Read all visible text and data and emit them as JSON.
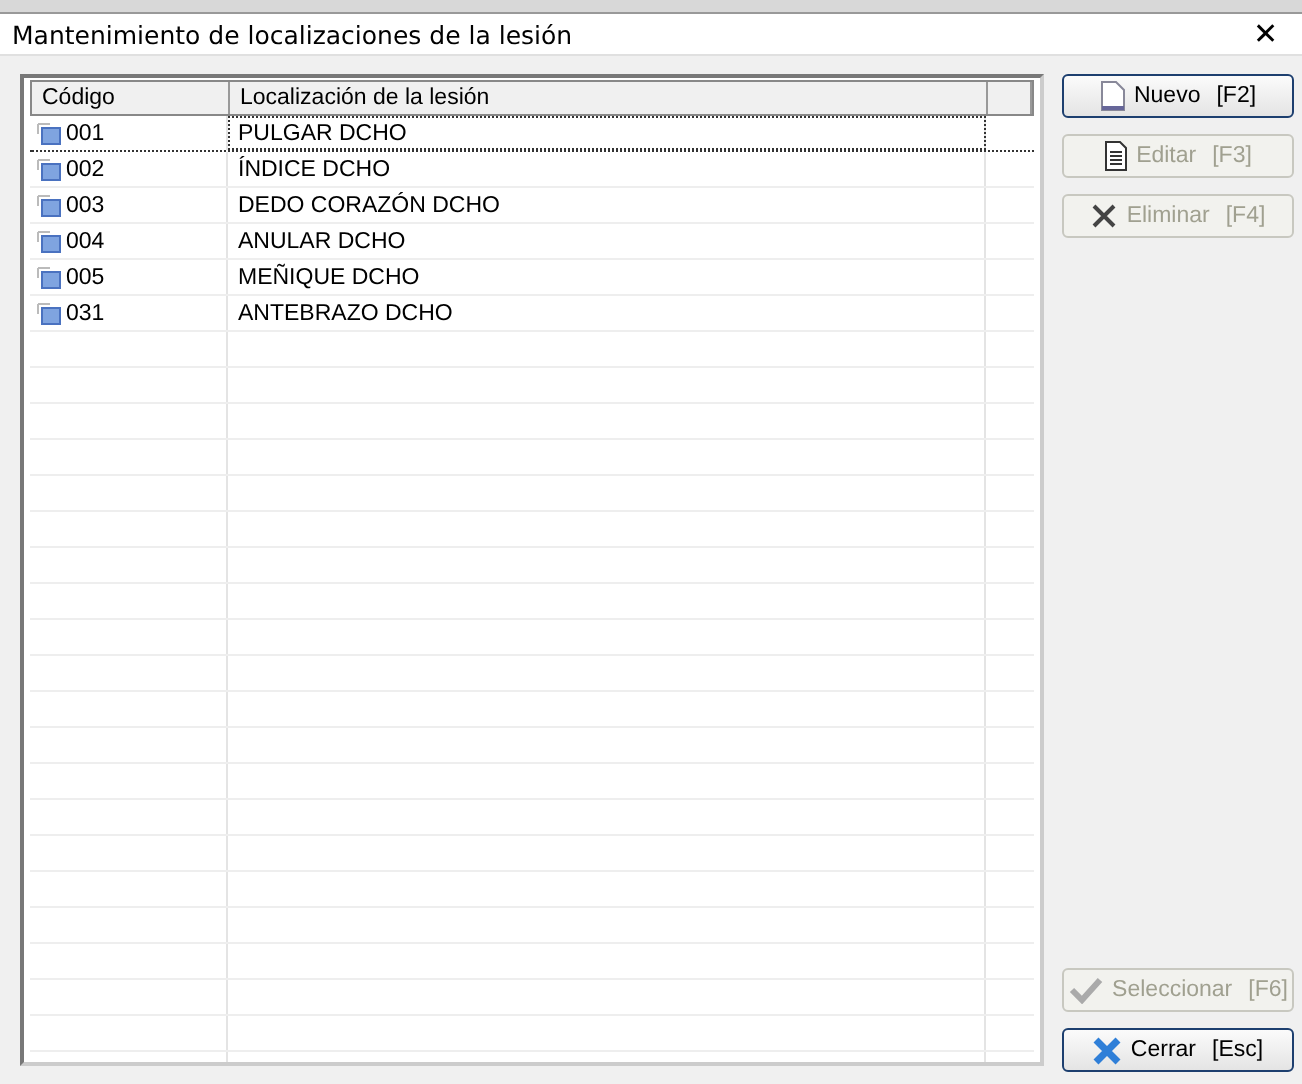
{
  "window": {
    "title": "Mantenimiento de localizaciones de la lesión",
    "close": "✕"
  },
  "table": {
    "columns": [
      "Código",
      "Localización de la lesión"
    ],
    "rows": [
      {
        "code": "001",
        "name": "PULGAR DCHO",
        "selected": true
      },
      {
        "code": "002",
        "name": "ÍNDICE DCHO",
        "selected": false
      },
      {
        "code": "003",
        "name": "DEDO CORAZÓN DCHO",
        "selected": false
      },
      {
        "code": "004",
        "name": "ANULAR DCHO",
        "selected": false
      },
      {
        "code": "005",
        "name": "MEÑIQUE DCHO",
        "selected": false
      },
      {
        "code": "031",
        "name": "ANTEBRAZO DCHO",
        "selected": false
      }
    ]
  },
  "buttons_top": [
    {
      "label": "Nuevo",
      "key": "[F2]",
      "kind": "new",
      "disabled": false
    },
    {
      "label": "Editar",
      "key": "[F3]",
      "kind": "edit",
      "disabled": true
    },
    {
      "label": "Eliminar",
      "key": "[F4]",
      "kind": "delete",
      "disabled": true
    }
  ],
  "buttons_bottom": [
    {
      "label": "Seleccionar",
      "key": "[F6]",
      "kind": "select",
      "disabled": true
    },
    {
      "label": "Cerrar",
      "key": "[Esc]",
      "kind": "close",
      "disabled": false
    }
  ]
}
